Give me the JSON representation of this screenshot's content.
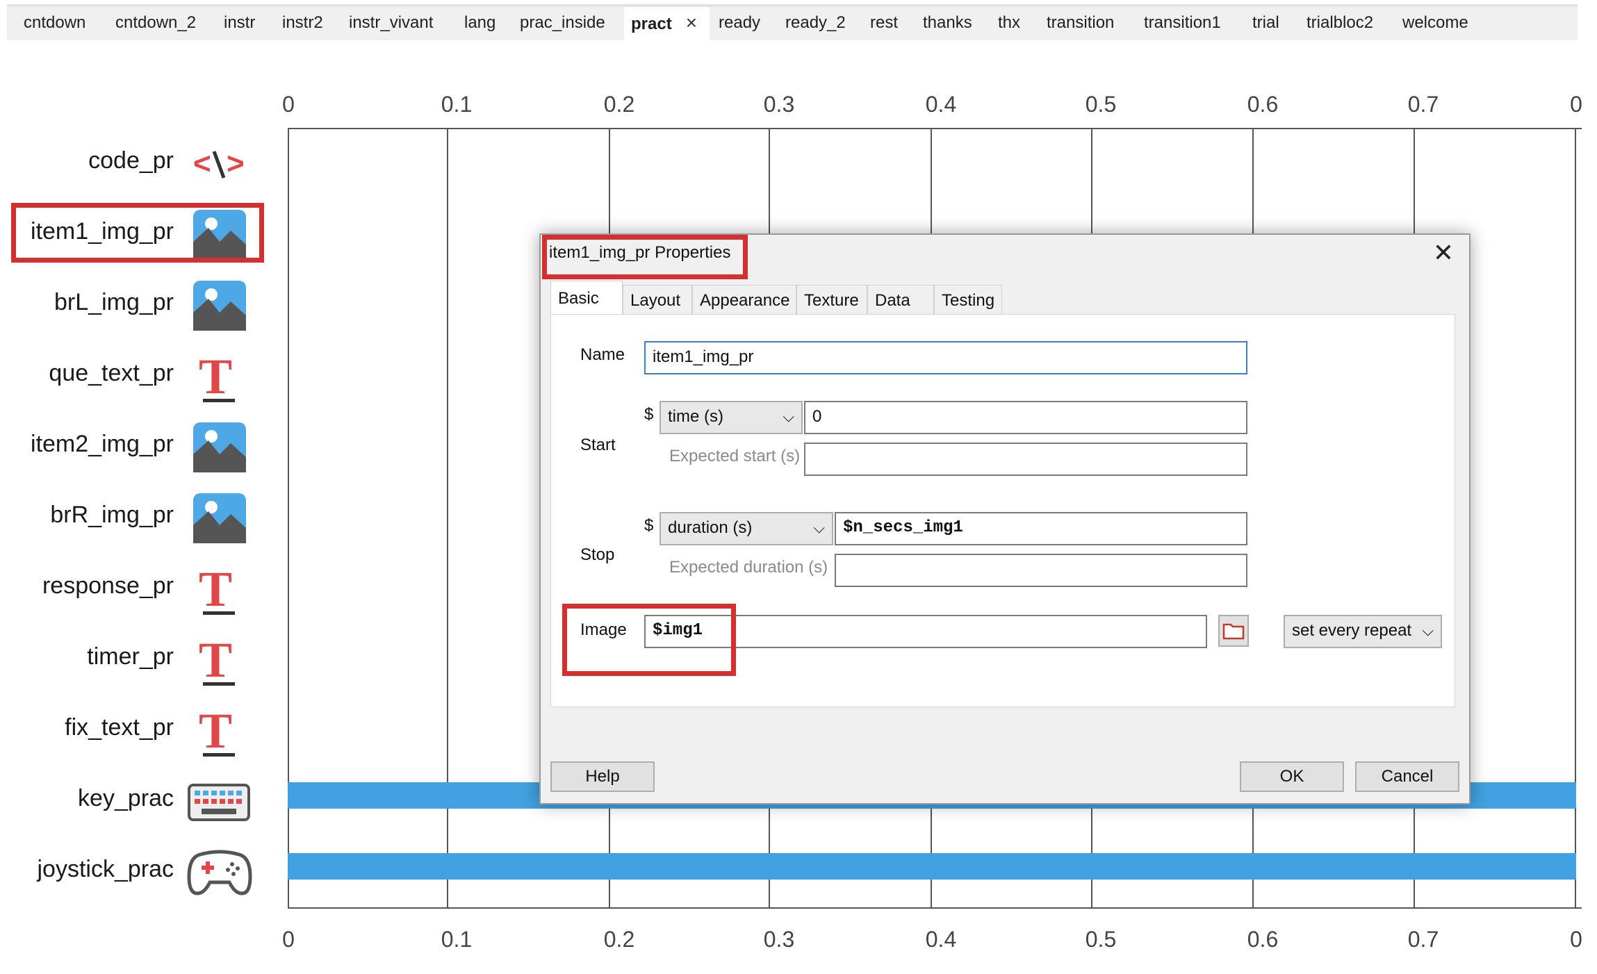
{
  "routine_tabs": [
    {
      "label": "cntdown"
    },
    {
      "label": "cntdown_2"
    },
    {
      "label": "instr"
    },
    {
      "label": "instr2"
    },
    {
      "label": "instr_vivant"
    },
    {
      "label": "lang"
    },
    {
      "label": "prac_inside"
    },
    {
      "label": "pract",
      "active": true,
      "close": "×"
    },
    {
      "label": "ready"
    },
    {
      "label": "ready_2"
    },
    {
      "label": "rest"
    },
    {
      "label": "thanks"
    },
    {
      "label": "thx"
    },
    {
      "label": "transition"
    },
    {
      "label": "transition1"
    },
    {
      "label": "trial"
    },
    {
      "label": "trialbloc2"
    },
    {
      "label": "welcome"
    }
  ],
  "axis_ticks": [
    "0",
    "0.1",
    "0.2",
    "0.3",
    "0.4",
    "0.5",
    "0.6",
    "0.7",
    "0"
  ],
  "components": [
    {
      "label": "code_pr",
      "icon": "code-icon"
    },
    {
      "label": "item1_img_pr",
      "icon": "image-icon",
      "highlighted": true
    },
    {
      "label": "brL_img_pr",
      "icon": "image-icon"
    },
    {
      "label": "que_text_pr",
      "icon": "text-icon"
    },
    {
      "label": "item2_img_pr",
      "icon": "image-icon"
    },
    {
      "label": "brR_img_pr",
      "icon": "image-icon"
    },
    {
      "label": "response_pr",
      "icon": "text-icon"
    },
    {
      "label": "timer_pr",
      "icon": "text-icon"
    },
    {
      "label": "fix_text_pr",
      "icon": "text-icon"
    },
    {
      "label": "key_prac",
      "icon": "keyboard-icon"
    },
    {
      "label": "joystick_prac",
      "icon": "joystick-icon"
    }
  ],
  "colors": {
    "highlight": "#d62f2f",
    "bar": "#42a1e0",
    "code_red": "#e04848"
  },
  "dialog": {
    "title": "item1_img_pr Properties",
    "close": "✕",
    "tabs": [
      "Basic",
      "Layout",
      "Appearance",
      "Texture",
      "Data",
      "Testing"
    ],
    "active_tab": "Basic",
    "name_label": "Name",
    "name_value": "item1_img_pr",
    "start_label": "Start",
    "start_dollar": "$",
    "start_type": "time (s)",
    "start_value": "0",
    "expected_start_label": "Expected start (s)",
    "expected_start_value": "",
    "stop_label": "Stop",
    "stop_dollar": "$",
    "stop_type": "duration (s)",
    "stop_value": "$n_secs_img1",
    "expected_duration_label": "Expected duration (s)",
    "expected_duration_value": "",
    "image_label": "Image",
    "image_value": "$img1",
    "image_update": "set every repeat",
    "help_button": "Help",
    "ok_button": "OK",
    "cancel_button": "Cancel"
  }
}
